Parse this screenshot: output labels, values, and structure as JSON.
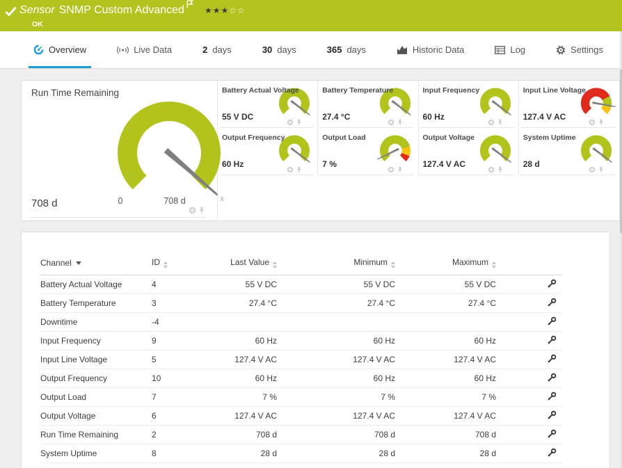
{
  "header": {
    "kind": "Sensor",
    "title": "SNMP Custom Advanced",
    "status": "OK",
    "priority_stars": {
      "filled": 3,
      "total": 5
    }
  },
  "tabs": [
    {
      "bold": "",
      "label": "Overview",
      "icon": "gauge-icon",
      "active": true
    },
    {
      "bold": "",
      "label": "Live Data",
      "icon": "live-data-icon",
      "active": false
    },
    {
      "bold": "2",
      "label": "days",
      "icon": "",
      "active": false
    },
    {
      "bold": "30",
      "label": "days",
      "icon": "",
      "active": false
    },
    {
      "bold": "365",
      "label": "days",
      "icon": "",
      "active": false
    },
    {
      "bold": "",
      "label": "Historic Data",
      "icon": "historic-data-icon",
      "active": false
    },
    {
      "bold": "",
      "label": "Log",
      "icon": "log-icon",
      "active": false
    },
    {
      "bold": "",
      "label": "Settings",
      "icon": "settings-gear-icon",
      "active": false
    }
  ],
  "colors": {
    "status_green": "#b4c41e",
    "ok_green": "#b2c31c",
    "error_red": "#e02a1a",
    "warning_yellow": "#fcc30e",
    "accent_blue": "#1e9cd7"
  },
  "gauges": {
    "big": {
      "label": "Run Time Remaining",
      "value": "708 d",
      "min_label": "0",
      "max_label": "708 d",
      "needle_frac": 0.985,
      "marker": "x̄",
      "segments": [
        {
          "color": "#b2c31c",
          "from": 0,
          "to": 1
        }
      ]
    },
    "small": [
      {
        "label": "Battery Actual Voltage",
        "value": "55 V DC",
        "needle_frac": 0.97,
        "segments": [
          {
            "color": "#b2c31c",
            "from": 0,
            "to": 1
          }
        ]
      },
      {
        "label": "Battery Temperature",
        "value": "27.4 °C",
        "needle_frac": 0.97,
        "segments": [
          {
            "color": "#b2c31c",
            "from": 0,
            "to": 1
          }
        ]
      },
      {
        "label": "Input Frequency",
        "value": "60 Hz",
        "needle_frac": 0.97,
        "segments": [
          {
            "color": "#b2c31c",
            "from": 0,
            "to": 1
          }
        ]
      },
      {
        "label": "Input Line Voltage",
        "value": "127.4 V AC",
        "needle_frac": 0.87,
        "segments": [
          {
            "color": "#e02a1a",
            "from": 0,
            "to": 0.73
          },
          {
            "color": "#b2c31c",
            "from": 0.73,
            "to": 0.9
          },
          {
            "color": "#fcc30e",
            "from": 0.9,
            "to": 1
          }
        ]
      },
      {
        "label": "Output Frequency",
        "value": "60 Hz",
        "needle_frac": 0.97,
        "segments": [
          {
            "color": "#b2c31c",
            "from": 0,
            "to": 1
          }
        ]
      },
      {
        "label": "Output Load",
        "value": "7 %",
        "needle_frac": 0.07,
        "segments": [
          {
            "color": "#b2c31c",
            "from": 0,
            "to": 0.78
          },
          {
            "color": "#fcc30e",
            "from": 0.78,
            "to": 0.91
          },
          {
            "color": "#e02a1a",
            "from": 0.91,
            "to": 1
          }
        ]
      },
      {
        "label": "Output Voltage",
        "value": "127.4 V AC",
        "needle_frac": 0.97,
        "segments": [
          {
            "color": "#b2c31c",
            "from": 0,
            "to": 1
          }
        ]
      },
      {
        "label": "System Uptime",
        "value": "28 d",
        "needle_frac": 0.97,
        "segments": [
          {
            "color": "#b2c31c",
            "from": 0,
            "to": 1
          }
        ]
      }
    ]
  },
  "channel_table": {
    "columns": [
      {
        "label": "Channel",
        "sort": "desc",
        "align": "left"
      },
      {
        "label": "ID",
        "sort": "none",
        "align": "left"
      },
      {
        "label": "Last Value",
        "sort": "none",
        "align": "right"
      },
      {
        "label": "Minimum",
        "sort": "none",
        "align": "right"
      },
      {
        "label": "Maximum",
        "sort": "none",
        "align": "right"
      }
    ],
    "rows": [
      [
        "Battery Actual Voltage",
        "4",
        "55 V DC",
        "55 V DC",
        "55 V DC"
      ],
      [
        "Battery Temperature",
        "3",
        "27.4 °C",
        "27.4 °C",
        "27.4 °C"
      ],
      [
        "Downtime",
        "-4",
        "",
        "",
        ""
      ],
      [
        "Input Frequency",
        "9",
        "60 Hz",
        "60 Hz",
        "60 Hz"
      ],
      [
        "Input Line Voltage",
        "5",
        "127.4 V AC",
        "127.4 V AC",
        "127.4 V AC"
      ],
      [
        "Output Frequency",
        "10",
        "60 Hz",
        "60 Hz",
        "60 Hz"
      ],
      [
        "Output Load",
        "7",
        "7 %",
        "7 %",
        "7 %"
      ],
      [
        "Output Voltage",
        "6",
        "127.4 V AC",
        "127.4 V AC",
        "127.4 V AC"
      ],
      [
        "Run Time Remaining",
        "2",
        "708 d",
        "708 d",
        "708 d"
      ],
      [
        "System Uptime",
        "8",
        "28 d",
        "28 d",
        "28 d"
      ]
    ]
  }
}
